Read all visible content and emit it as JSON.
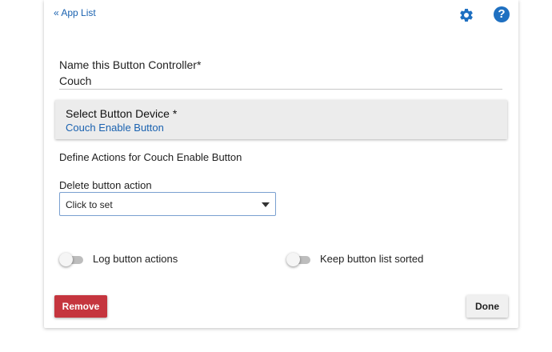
{
  "header": {
    "back_link": "« App List",
    "settings_icon": "gear-icon",
    "help_icon": "help-icon",
    "help_glyph": "?",
    "accent_color": "#1f70c1"
  },
  "form": {
    "name_label": "Name this Button Controller*",
    "name_value": "Couch",
    "device": {
      "title": "Select Button Device *",
      "value": "Couch Enable Button"
    },
    "define_text": "Define Actions for Couch Enable Button",
    "delete_action": {
      "label": "Delete button action",
      "selected": "Click to set"
    },
    "toggles": [
      {
        "label": "Log button actions",
        "on": false
      },
      {
        "label": "Keep button list sorted",
        "on": false
      }
    ]
  },
  "footer": {
    "remove_label": "Remove",
    "done_label": "Done",
    "remove_color": "#c5353e"
  }
}
